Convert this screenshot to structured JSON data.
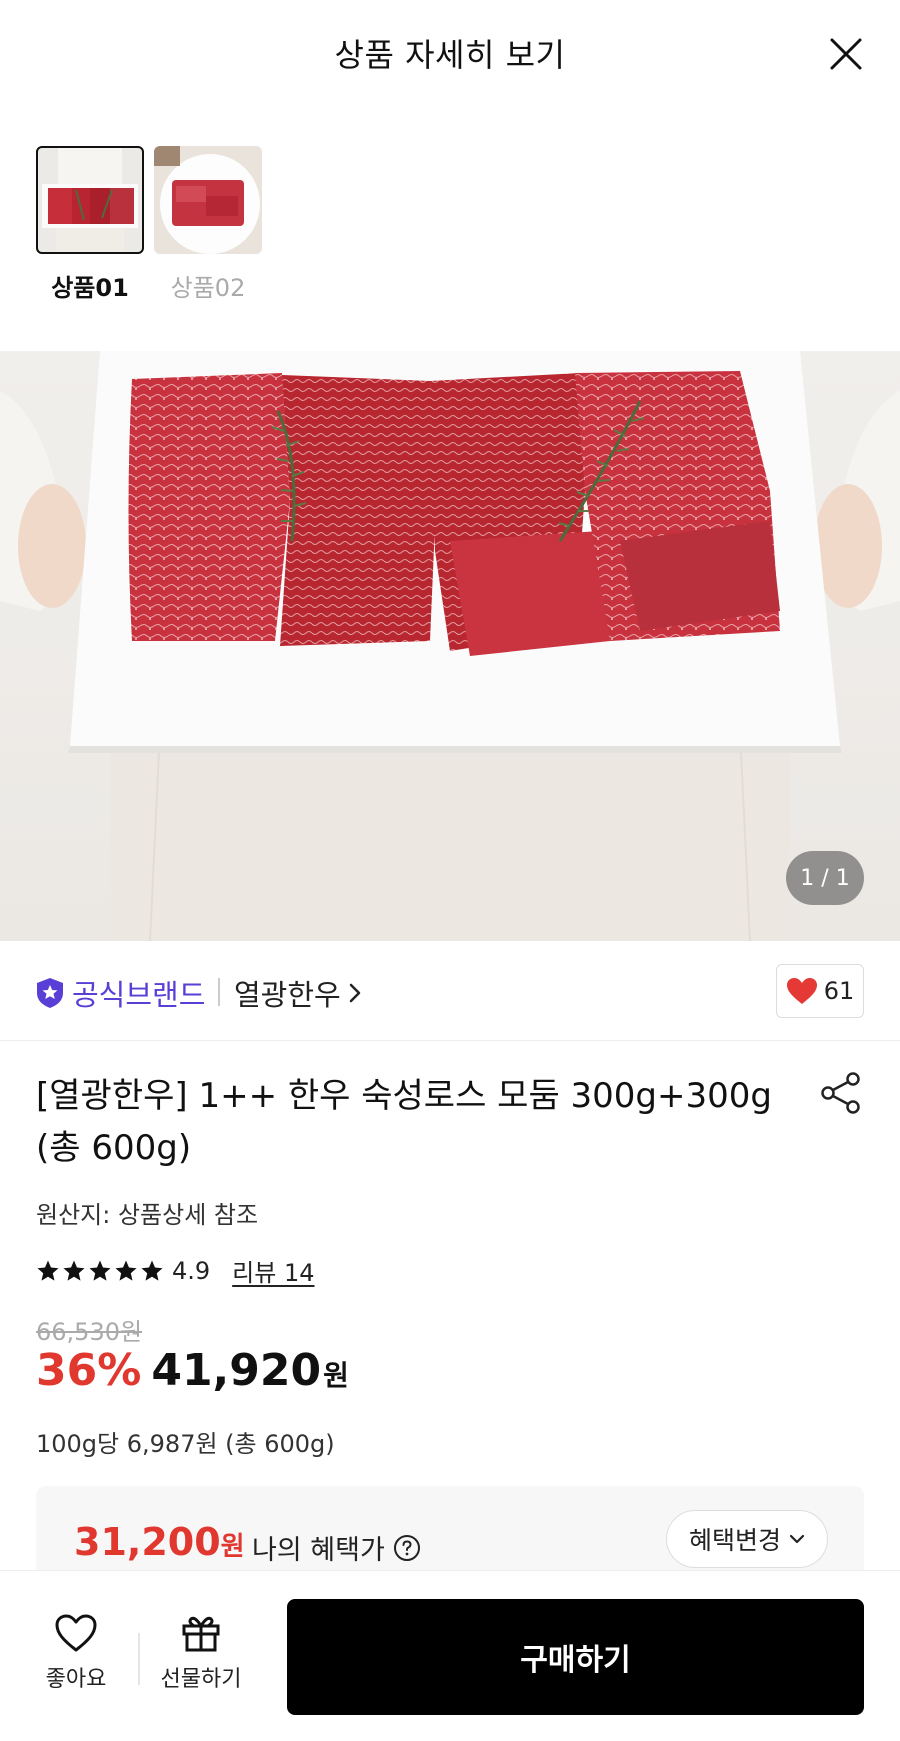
{
  "header": {
    "title": "상품 자세히 보기"
  },
  "thumbnails": [
    {
      "label": "상품01",
      "active": true
    },
    {
      "label": "상품02",
      "active": false
    }
  ],
  "gallery": {
    "indicator": "1 / 1"
  },
  "brand": {
    "badge_label": "공식브랜드",
    "name": "열광한우",
    "like_count": "61"
  },
  "product": {
    "title": "[열광한우] 1++ 한우 숙성로스 모둠 300g+300g (총 600g)",
    "origin": "원산지: 상품상세 참조",
    "rating": "4.9",
    "review_link": "리뷰 14",
    "star_count": 5,
    "original_price": "66,530원",
    "discount": "36%",
    "price": "41,920",
    "currency": "원",
    "unit_price": "100g당 6,987원 (총 600g)"
  },
  "benefit": {
    "price": "31,200",
    "currency": "원",
    "label": "나의 혜택가",
    "change_button": "혜택변경"
  },
  "bottom_bar": {
    "like_label": "좋아요",
    "gift_label": "선물하기",
    "buy_label": "구매하기"
  },
  "colors": {
    "accent_red": "#e0372f",
    "brand_purple": "#5a3fd6",
    "heart_red": "#e53935",
    "buy_button": "#000000"
  }
}
